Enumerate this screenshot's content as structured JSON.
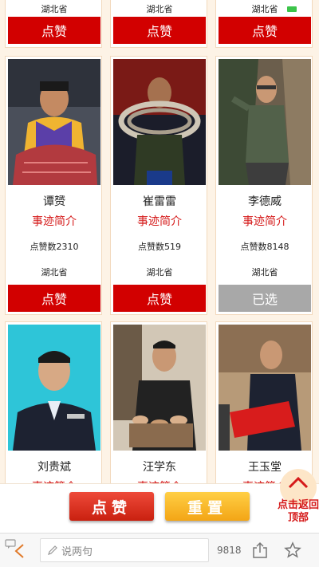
{
  "top_row": {
    "province": [
      "湖北省",
      "湖北省",
      "湖北省"
    ],
    "button_label": "点赞"
  },
  "cards": [
    {
      "name": "谭赟",
      "intro": "事迹简介",
      "votes": "点赞数2310",
      "province": "湖北省",
      "button": "点赞",
      "selected": false
    },
    {
      "name": "崔雷雷",
      "intro": "事迹简介",
      "votes": "点赞数519",
      "province": "湖北省",
      "button": "点赞",
      "selected": false
    },
    {
      "name": "李德威",
      "intro": "事迹简介",
      "votes": "点赞数8148",
      "province": "湖北省",
      "button": "已选",
      "selected": true
    },
    {
      "name": "刘贵斌",
      "intro": "事迹简介"
    },
    {
      "name": "汪学东",
      "intro": "事迹简介"
    },
    {
      "name": "王玉堂",
      "intro": "事迹简介"
    }
  ],
  "action_bar": {
    "like_label": "点赞",
    "reset_label": "重置",
    "back_top_label": "点击返回顶部"
  },
  "comment_bar": {
    "placeholder": "说两句",
    "comment_count": "9818"
  },
  "colors": {
    "accent_red": "#d20000",
    "selected_gray": "#a8a8a8",
    "page_bg": "#fdf3e6"
  }
}
